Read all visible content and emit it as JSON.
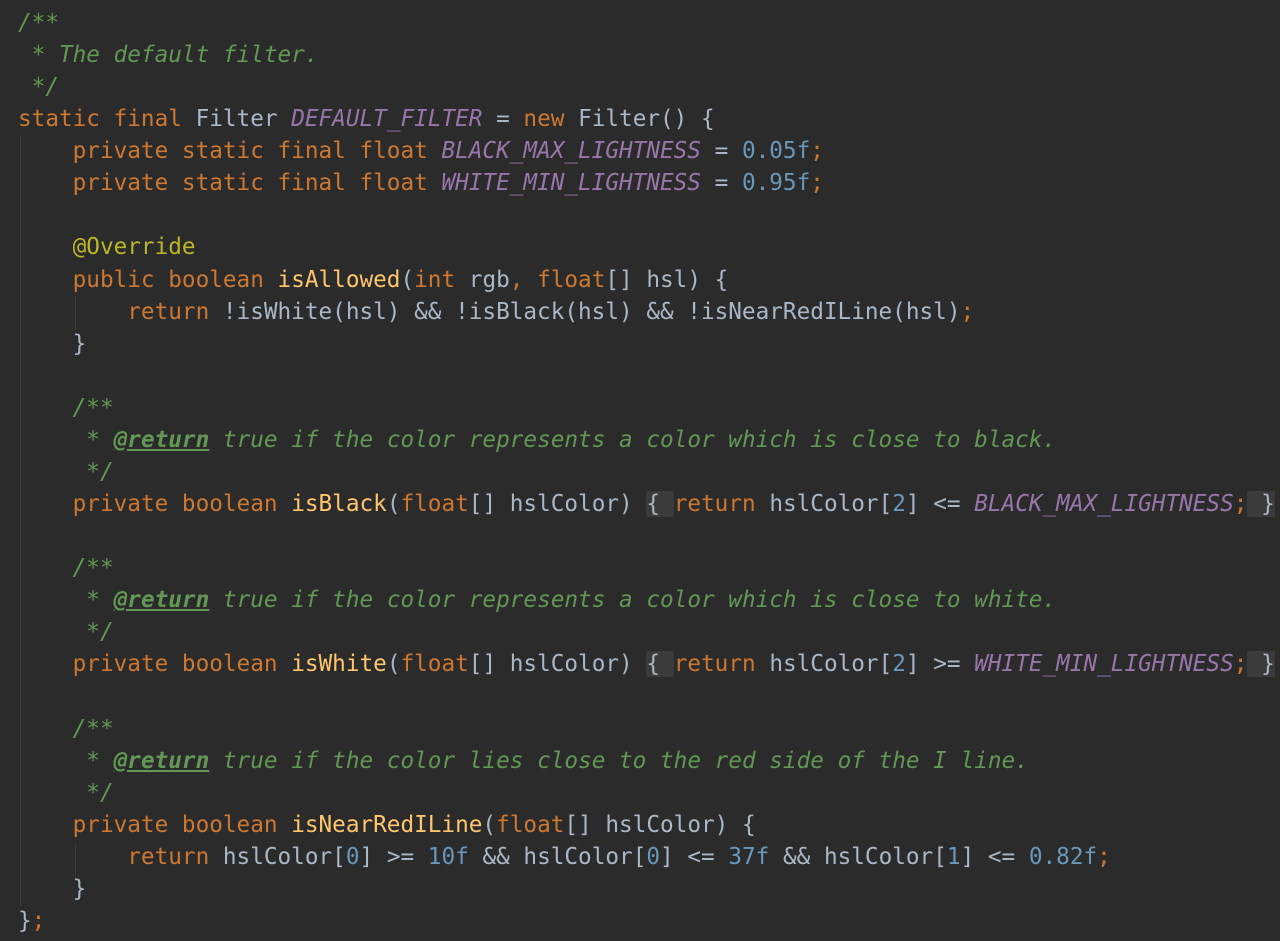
{
  "editor": {
    "colors": {
      "background": "#2b2b2b",
      "keyword": "#cc7832",
      "plain": "#a9b7c6",
      "field": "#9876aa",
      "number": "#6897bb",
      "function": "#ffc66d",
      "annotation": "#bbb529",
      "doc_comment": "#629755",
      "fold_region": "#3b3b3b"
    },
    "lines": [
      [
        [
          "doc",
          "/**"
        ]
      ],
      [
        [
          "doc",
          " * The default filter."
        ]
      ],
      [
        [
          "doc",
          " */"
        ]
      ],
      [
        [
          "kw",
          "static final "
        ],
        [
          "plain",
          "Filter "
        ],
        [
          "field",
          "DEFAULT_FILTER"
        ],
        [
          "plain",
          " = "
        ],
        [
          "kw",
          "new "
        ],
        [
          "plain",
          "Filter() {"
        ]
      ],
      [
        [
          "kw",
          "    private static final float "
        ],
        [
          "field",
          "BLACK_MAX_LIGHTNESS"
        ],
        [
          "plain",
          " = "
        ],
        [
          "num",
          "0.05f"
        ],
        [
          "kw",
          ";"
        ]
      ],
      [
        [
          "kw",
          "    private static final float "
        ],
        [
          "field",
          "WHITE_MIN_LIGHTNESS"
        ],
        [
          "plain",
          " = "
        ],
        [
          "num",
          "0.95f"
        ],
        [
          "kw",
          ";"
        ]
      ],
      [],
      [
        [
          "anno",
          "    @Override"
        ]
      ],
      [
        [
          "kw",
          "    public boolean "
        ],
        [
          "fn",
          "isAllowed"
        ],
        [
          "plain",
          "("
        ],
        [
          "kw",
          "int "
        ],
        [
          "plain",
          "rgb"
        ],
        [
          "kw",
          ", float"
        ],
        [
          "plain",
          "[] hsl) {"
        ]
      ],
      [
        [
          "kw",
          "        return "
        ],
        [
          "plain",
          "!isWhite(hsl) && !isBlack(hsl) && !isNearRedILine(hsl)"
        ],
        [
          "kw",
          ";"
        ]
      ],
      [
        [
          "plain",
          "    }"
        ]
      ],
      [],
      [
        [
          "doc",
          "    /**"
        ]
      ],
      [
        [
          "doc",
          "     * "
        ],
        [
          "doctag",
          "@return"
        ],
        [
          "doc",
          " true if the color represents a color which is close to black."
        ]
      ],
      [
        [
          "doc",
          "     */"
        ]
      ],
      [
        [
          "kw",
          "    private boolean "
        ],
        [
          "fn",
          "isBlack"
        ],
        [
          "plain",
          "("
        ],
        [
          "kw",
          "float"
        ],
        [
          "plain",
          "[] hslColor) "
        ],
        [
          "fold",
          "{ "
        ],
        [
          "kw",
          "return "
        ],
        [
          "plain",
          "hslColor["
        ],
        [
          "num",
          "2"
        ],
        [
          "plain",
          "] <= "
        ],
        [
          "field",
          "BLACK_MAX_LIGHTNESS"
        ],
        [
          "kw",
          ";"
        ],
        [
          "fold",
          " }"
        ]
      ],
      [],
      [
        [
          "doc",
          "    /**"
        ]
      ],
      [
        [
          "doc",
          "     * "
        ],
        [
          "doctag",
          "@return"
        ],
        [
          "doc",
          " true if the color represents a color which is close to white."
        ]
      ],
      [
        [
          "doc",
          "     */"
        ]
      ],
      [
        [
          "kw",
          "    private boolean "
        ],
        [
          "fn",
          "isWhite"
        ],
        [
          "plain",
          "("
        ],
        [
          "kw",
          "float"
        ],
        [
          "plain",
          "[] hslColor) "
        ],
        [
          "fold",
          "{ "
        ],
        [
          "kw",
          "return "
        ],
        [
          "plain",
          "hslColor["
        ],
        [
          "num",
          "2"
        ],
        [
          "plain",
          "] >= "
        ],
        [
          "field",
          "WHITE_MIN_LIGHTNESS"
        ],
        [
          "kw",
          ";"
        ],
        [
          "fold",
          " }"
        ]
      ],
      [],
      [
        [
          "doc",
          "    /**"
        ]
      ],
      [
        [
          "doc",
          "     * "
        ],
        [
          "doctag",
          "@return"
        ],
        [
          "doc",
          " true if the color lies close to the red side of the I line."
        ]
      ],
      [
        [
          "doc",
          "     */"
        ]
      ],
      [
        [
          "kw",
          "    private boolean "
        ],
        [
          "fn",
          "isNearRedILine"
        ],
        [
          "plain",
          "("
        ],
        [
          "kw",
          "float"
        ],
        [
          "plain",
          "[] hslColor) {"
        ]
      ],
      [
        [
          "kw",
          "        return "
        ],
        [
          "plain",
          "hslColor["
        ],
        [
          "num",
          "0"
        ],
        [
          "plain",
          "] >= "
        ],
        [
          "num",
          "10f"
        ],
        [
          "plain",
          " && hslColor["
        ],
        [
          "num",
          "0"
        ],
        [
          "plain",
          "] <= "
        ],
        [
          "num",
          "37f"
        ],
        [
          "plain",
          " && hslColor["
        ],
        [
          "num",
          "1"
        ],
        [
          "plain",
          "] <= "
        ],
        [
          "num",
          "0.82f"
        ],
        [
          "kw",
          ";"
        ]
      ],
      [
        [
          "plain",
          "    }"
        ]
      ],
      [
        [
          "plain",
          "}"
        ],
        [
          "kw",
          ";"
        ]
      ]
    ]
  }
}
